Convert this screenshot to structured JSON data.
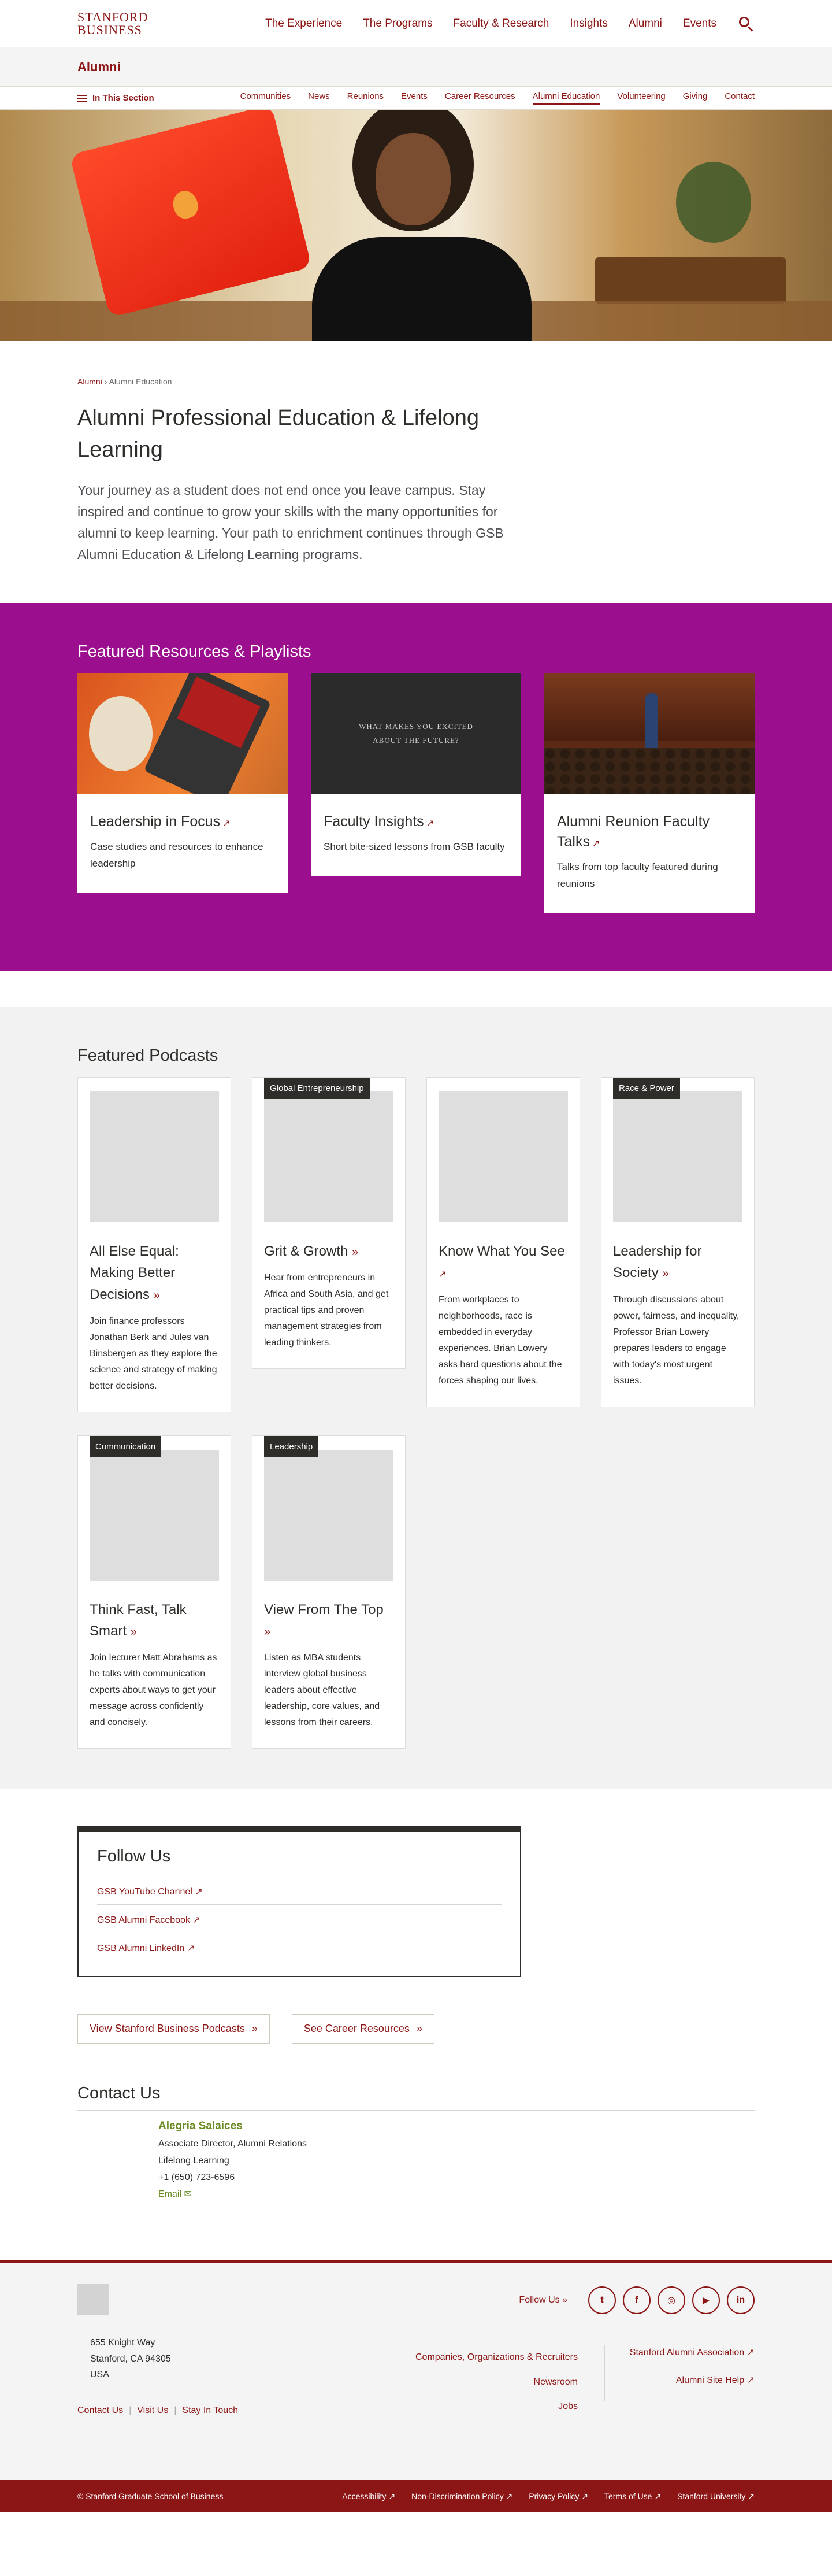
{
  "header": {
    "logo_line1": "STANFORD",
    "logo_line2": "BUSINESS",
    "nav": [
      "The Experience",
      "The Programs",
      "Faculty & Research",
      "Insights",
      "Alumni",
      "Events"
    ]
  },
  "section": {
    "title": "Alumni",
    "in_section": "In This Section",
    "items": [
      "Communities",
      "News",
      "Reunions",
      "Events",
      "Career Resources",
      "Alumni Education",
      "Volunteering",
      "Giving",
      "Contact"
    ],
    "active": "Alumni Education"
  },
  "intro": {
    "breadcrumb_root": "Alumni",
    "breadcrumb_sep": "›",
    "breadcrumb_current": "Alumni Education",
    "title": "Alumni Professional Education & Lifelong Learning",
    "body": "Your journey as a student does not end once you leave campus. Stay inspired and continue to grow your skills with the many opportunities for alumni to keep learning. Your path to enrichment continues through GSB Alumni Education & Lifelong Learning programs."
  },
  "resources": {
    "heading": "Featured Resources & Playlists",
    "cards": [
      {
        "title": "Leadership in Focus",
        "desc": "Case studies and resources to enhance leadership"
      },
      {
        "title": "Faculty Insights",
        "desc": "Short bite-sized lessons from GSB faculty",
        "image_text": "WHAT MAKES YOU EXCITED ABOUT THE FUTURE?"
      },
      {
        "title": "Alumni Reunion Faculty Talks",
        "desc": "Talks from top faculty featured during reunions"
      }
    ]
  },
  "podcasts": {
    "heading": "Featured Podcasts",
    "cards": [
      {
        "tag": "",
        "title": "All Else Equal: Making Better Decisions",
        "desc": "Join finance professors Jonathan Berk and Jules van Binsbergen as they explore the science and strategy of making better decisions."
      },
      {
        "tag": "Global Entrepreneurship",
        "title": "Grit & Growth",
        "desc": "Hear from entrepreneurs in Africa and South Asia, and get practical tips and proven management strategies from leading thinkers."
      },
      {
        "tag": "",
        "title": "Know What You See",
        "desc": "From workplaces to neighborhoods, race is embedded in everyday experiences. Brian Lowery asks hard questions about the forces shaping our lives."
      },
      {
        "tag": "Race & Power",
        "title": "Leadership for Society",
        "desc": "Through discussions about power, fairness, and inequality, Professor Brian Lowery prepares leaders to engage with today's most urgent issues."
      },
      {
        "tag": "Communication",
        "title": "Think Fast, Talk Smart",
        "desc": "Join lecturer Matt Abrahams as he talks with communication experts about ways to get your message across confidently and concisely."
      },
      {
        "tag": "Leadership",
        "title": "View From The Top",
        "desc": "Listen as MBA students interview global business leaders about effective leadership, core values, and lessons from their careers."
      }
    ]
  },
  "follow": {
    "heading": "Follow Us",
    "links": [
      "GSB YouTube Channel",
      "GSB Alumni Facebook",
      "GSB Alumni LinkedIn"
    ]
  },
  "ctas": [
    "View Stanford Business Podcasts",
    "See Career Resources"
  ],
  "contact": {
    "heading": "Contact Us",
    "name": "Alegria Salaices",
    "title": "Associate Director, Alumni Relations",
    "dept": "Lifelong Learning",
    "phone": "+1 (650) 723-6596",
    "email": "Email"
  },
  "footer": {
    "follow_label": "Follow Us",
    "social": [
      "twitter",
      "facebook",
      "instagram",
      "youtube",
      "linkedin"
    ],
    "address": [
      "655 Knight Way",
      "Stanford, CA 94305",
      "USA"
    ],
    "links": [
      "Contact Us",
      "Visit Us",
      "Stay In Touch"
    ],
    "col_a": [
      "Companies, Organizations & Recruiters",
      "Newsroom",
      "Jobs"
    ],
    "col_b": [
      "Stanford Alumni Association",
      "Alumni Site Help"
    ],
    "copyright": "© Stanford Graduate School of Business",
    "bottom_links": [
      "Accessibility",
      "Non-Discrimination Policy",
      "Privacy Policy",
      "Terms of Use",
      "Stanford University"
    ]
  },
  "colors": {
    "cardinal": "#8c1515",
    "purple": "#9b0f8e",
    "green": "#6a8a22"
  }
}
